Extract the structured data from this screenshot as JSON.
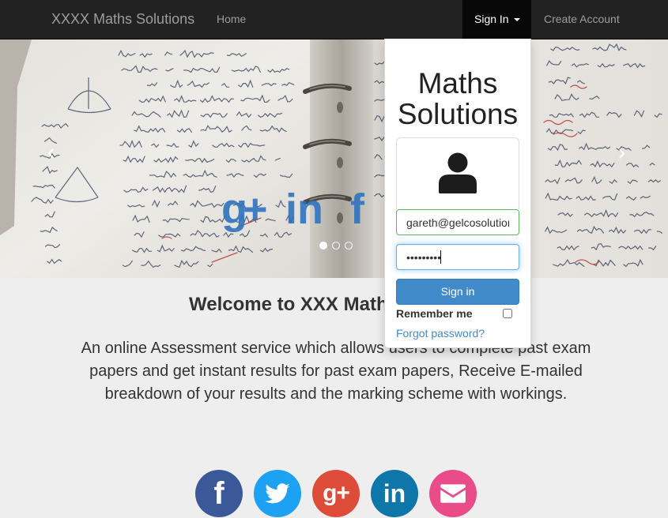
{
  "navbar": {
    "brand": "XXXX Maths Solutions",
    "home_label": "Home",
    "signin_label": "Sign In",
    "signin_caret_icon": "caret-down-icon",
    "create_account_label": "Create Account",
    "background": "#222222",
    "active_background": "#080808",
    "link_color": "#9d9d9d"
  },
  "carousel": {
    "prev_icon": "chevron-left-icon",
    "next_icon": "chevron-right-icon",
    "social_icons": [
      {
        "icon": "google-plus-icon",
        "glyph": "g+"
      },
      {
        "icon": "linkedin-icon",
        "glyph": "in"
      },
      {
        "icon": "facebook-icon",
        "glyph": "f"
      }
    ],
    "social_icon_color": "#2f73bf",
    "indicators": {
      "count": 3,
      "active_index": 0
    }
  },
  "login": {
    "title": "Maths Solutions",
    "avatar_icon": "user-icon",
    "email_value": "gareth@gelcosolution",
    "password_value": "•••••••••",
    "signin_button_label": "Sign in",
    "remember_me_label": "Remember me",
    "remember_me_checked": false,
    "forgot_password_label": "Forgot password?",
    "email_border_color": "#5cb85c",
    "focus_border_color": "#66afe9",
    "button_color": "#428bca",
    "link_color": "#428bca"
  },
  "welcome": {
    "heading": "Welcome to XXX Math",
    "description_lines": [
      "An online Assessment service which allows users to complete past exam",
      "papers and get instant results for past exam papers, Receive E-mailed",
      "breakdown of your results and the marking scheme with workings."
    ]
  },
  "social_links": [
    {
      "icon": "facebook-icon",
      "glyph": "f",
      "color": "#3b5998"
    },
    {
      "icon": "twitter-icon",
      "color": "#1da1f2"
    },
    {
      "icon": "google-plus-icon",
      "glyph": "g+",
      "color": "#dd4b39"
    },
    {
      "icon": "linkedin-icon",
      "glyph": "in",
      "color": "#0e76a8"
    },
    {
      "icon": "email-icon",
      "color": "#ea4c89"
    }
  ],
  "page": {
    "background": "#eeeeee",
    "text_color": "#333333"
  }
}
